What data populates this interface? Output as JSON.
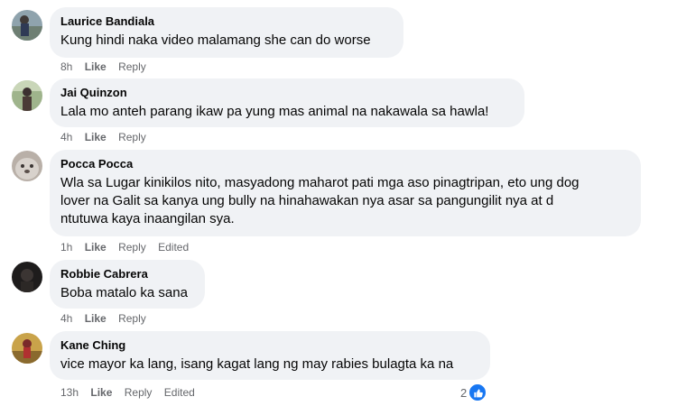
{
  "comments": [
    {
      "author": "Laurice Bandiala",
      "text": "Kung hindi naka video malamang she can do worse",
      "time": "8h",
      "like_label": "Like",
      "reply_label": "Reply"
    },
    {
      "author": "Jai Quinzon",
      "text": "Lala mo anteh parang ikaw pa yung mas animal na nakawala sa hawla!",
      "time": "4h",
      "like_label": "Like",
      "reply_label": "Reply"
    },
    {
      "author": "Pocca Pocca",
      "text_lines": [
        "Wla sa Lugar kinikilos nito, masyadong maharot pati mga aso pinagtripan, eto ung dog",
        "lover na Galit sa kanya ung bully na hinahawakan nya asar sa pangungilit nya at d",
        "ntutuwa kaya inaangilan sya."
      ],
      "time": "1h",
      "like_label": "Like",
      "reply_label": "Reply",
      "edited_label": "Edited"
    },
    {
      "author": "Robbie Cabrera",
      "text": "Boba matalo ka sana",
      "time": "4h",
      "like_label": "Like",
      "reply_label": "Reply"
    },
    {
      "author": "Kane Ching",
      "text": "vice mayor ka lang, isang kagat lang ng may rabies bulagta ka na",
      "time": "13h",
      "like_label": "Like",
      "reply_label": "Reply",
      "edited_label": "Edited",
      "reaction_count": "2",
      "reaction_icon": "like-icon"
    }
  ],
  "colors": {
    "bubble": "#f0f2f5",
    "meta_text": "#65676b",
    "like_blue": "#1877f2"
  }
}
